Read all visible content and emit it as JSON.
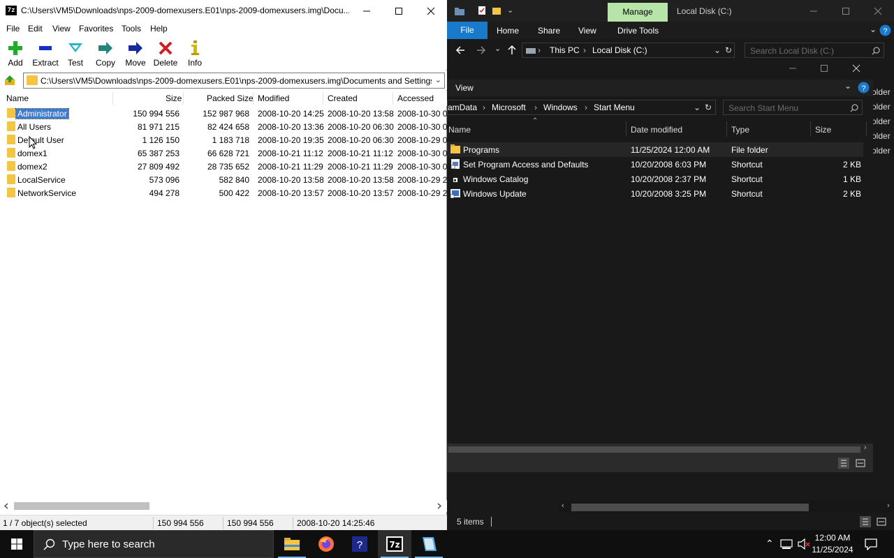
{
  "sevenzip": {
    "title": "C:\\Users\\VM5\\Downloads\\nps-2009-domexusers.E01\\nps-2009-domexusers.img\\Docu...",
    "app_icon_text": "7z",
    "menu": [
      "File",
      "Edit",
      "View",
      "Favorites",
      "Tools",
      "Help"
    ],
    "toolbar": [
      "Add",
      "Extract",
      "Test",
      "Copy",
      "Move",
      "Delete",
      "Info"
    ],
    "address": "C:\\Users\\VM5\\Downloads\\nps-2009-domexusers.E01\\nps-2009-domexusers.img\\Documents and Settings\\",
    "columns": [
      "Name",
      "Size",
      "Packed Size",
      "Modified",
      "Created",
      "Accessed"
    ],
    "rows": [
      {
        "name": "Administrator",
        "size": "150 994 556",
        "packed": "152 987 968",
        "modified": "2008-10-20 14:25",
        "created": "2008-10-20 13:58",
        "accessed": "2008-10-30 0"
      },
      {
        "name": "All Users",
        "size": "81 971 215",
        "packed": "82 424 658",
        "modified": "2008-10-20 13:36",
        "created": "2008-10-20 06:30",
        "accessed": "2008-10-30 0"
      },
      {
        "name": "Default User",
        "size": "1 126 150",
        "packed": "1 183 718",
        "modified": "2008-10-20 19:35",
        "created": "2008-10-20 06:30",
        "accessed": "2008-10-29 0"
      },
      {
        "name": "domex1",
        "size": "65 387 253",
        "packed": "66 628 721",
        "modified": "2008-10-21 11:12",
        "created": "2008-10-21 11:12",
        "accessed": "2008-10-30 0"
      },
      {
        "name": "domex2",
        "size": "27 809 492",
        "packed": "28 735 652",
        "modified": "2008-10-21 11:29",
        "created": "2008-10-21 11:29",
        "accessed": "2008-10-30 0"
      },
      {
        "name": "LocalService",
        "size": "573 096",
        "packed": "582 840",
        "modified": "2008-10-20 13:58",
        "created": "2008-10-20 13:58",
        "accessed": "2008-10-29 2"
      },
      {
        "name": "NetworkService",
        "size": "494 278",
        "packed": "500 422",
        "modified": "2008-10-20 13:57",
        "created": "2008-10-20 13:57",
        "accessed": "2008-10-29 2"
      }
    ],
    "status": {
      "selection": "1 / 7 object(s) selected",
      "size": "150 994 556",
      "packed": "150 994 556",
      "date": "2008-10-20 14:25:46"
    }
  },
  "explorer_back": {
    "manage_tab": "Manage",
    "title": "Local Disk (C:)",
    "ribbon": [
      "File",
      "Home",
      "Share",
      "View",
      "Drive Tools"
    ],
    "breadcrumb": [
      "This PC",
      "Local Disk (C:)"
    ],
    "search_placeholder": "Search Local Disk (C:)",
    "side_items": [
      "older",
      "older",
      "older",
      "older",
      "older"
    ],
    "status": "5 items"
  },
  "explorer_front": {
    "ribbon_tab": "View",
    "breadcrumb": [
      "amData",
      "Microsoft",
      "Windows",
      "Start Menu"
    ],
    "search_placeholder": "Search Start Menu",
    "columns": [
      "Name",
      "Date modified",
      "Type",
      "Size"
    ],
    "rows": [
      {
        "name": "Programs",
        "date": "11/25/2024 12:00 AM",
        "type": "File folder",
        "size": "",
        "icon": "folder-icon"
      },
      {
        "name": "Set Program Access and Defaults",
        "date": "10/20/2008 6:03 PM",
        "type": "Shortcut",
        "size": "2 KB",
        "icon": "shortcut-icon"
      },
      {
        "name": "Windows Catalog",
        "date": "10/20/2008 2:37 PM",
        "type": "Shortcut",
        "size": "1 KB",
        "icon": "shortcut-icon"
      },
      {
        "name": "Windows Update",
        "date": "10/20/2008 3:25 PM",
        "type": "Shortcut",
        "size": "2 KB",
        "icon": "shortcut-icon"
      }
    ]
  },
  "taskbar": {
    "search_placeholder": "Type here to search",
    "time": "12:00 AM",
    "date": "11/25/2024"
  },
  "colors": {
    "selection": "#3a7bd5",
    "folder": "#f4c542",
    "manage_tab": "#b7e4a8",
    "file_tab": "#1979ca",
    "taskbar_accent": "#76b9ed"
  }
}
